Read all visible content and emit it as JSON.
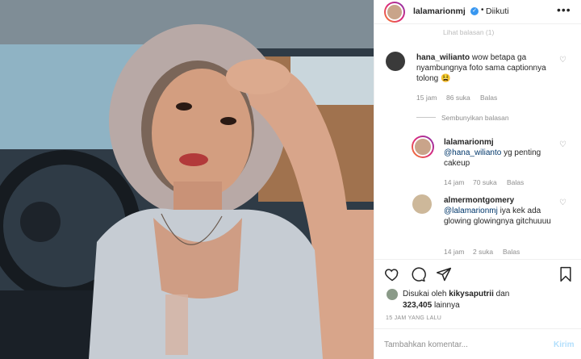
{
  "post": {
    "author": "lalamarionmj",
    "follow_status": "Diikuti",
    "separator": "•",
    "verified_glyph": "✓",
    "more_glyph": "•••"
  },
  "comments": {
    "faded_top": "Lihat balasan (1)",
    "hide_replies_label": "Sembunyikan balasan",
    "items": [
      {
        "username": "hana_wilianto",
        "text": "wow betapa ga nyambungnya foto sama captionnya tolong 😫",
        "time": "15 jam",
        "likes": "86 suka",
        "reply": "Balas"
      },
      {
        "username": "lalamarionmj",
        "mention": "@hana_wilianto",
        "text": "yg penting cakeup",
        "time": "14 jam",
        "likes": "70 suka",
        "reply": "Balas"
      },
      {
        "username": "almermontgomery",
        "mention": "@lalamarionmj",
        "text": "iya kek ada glowing glowingnya gitchuuuu",
        "time": "14 jam",
        "likes": "2 suka",
        "reply": "Balas"
      }
    ]
  },
  "actions": {
    "icons": [
      "heart-icon",
      "comment-icon",
      "share-icon",
      "bookmark-icon"
    ]
  },
  "likes": {
    "prefix": "Disukai oleh",
    "liker": "kikysaputrii",
    "conjunction": "dan",
    "count": "323,405",
    "suffix": "lainnya"
  },
  "timestamp": "15 JAM YANG LALU",
  "add_comment": {
    "placeholder": "Tambahkan komentar...",
    "post_label": "Kirim"
  },
  "colors": {
    "accent": "#3897f0",
    "post_button_disabled": "#b2dffc",
    "muted_text": "#8e8e8e",
    "mention": "#00376b"
  }
}
